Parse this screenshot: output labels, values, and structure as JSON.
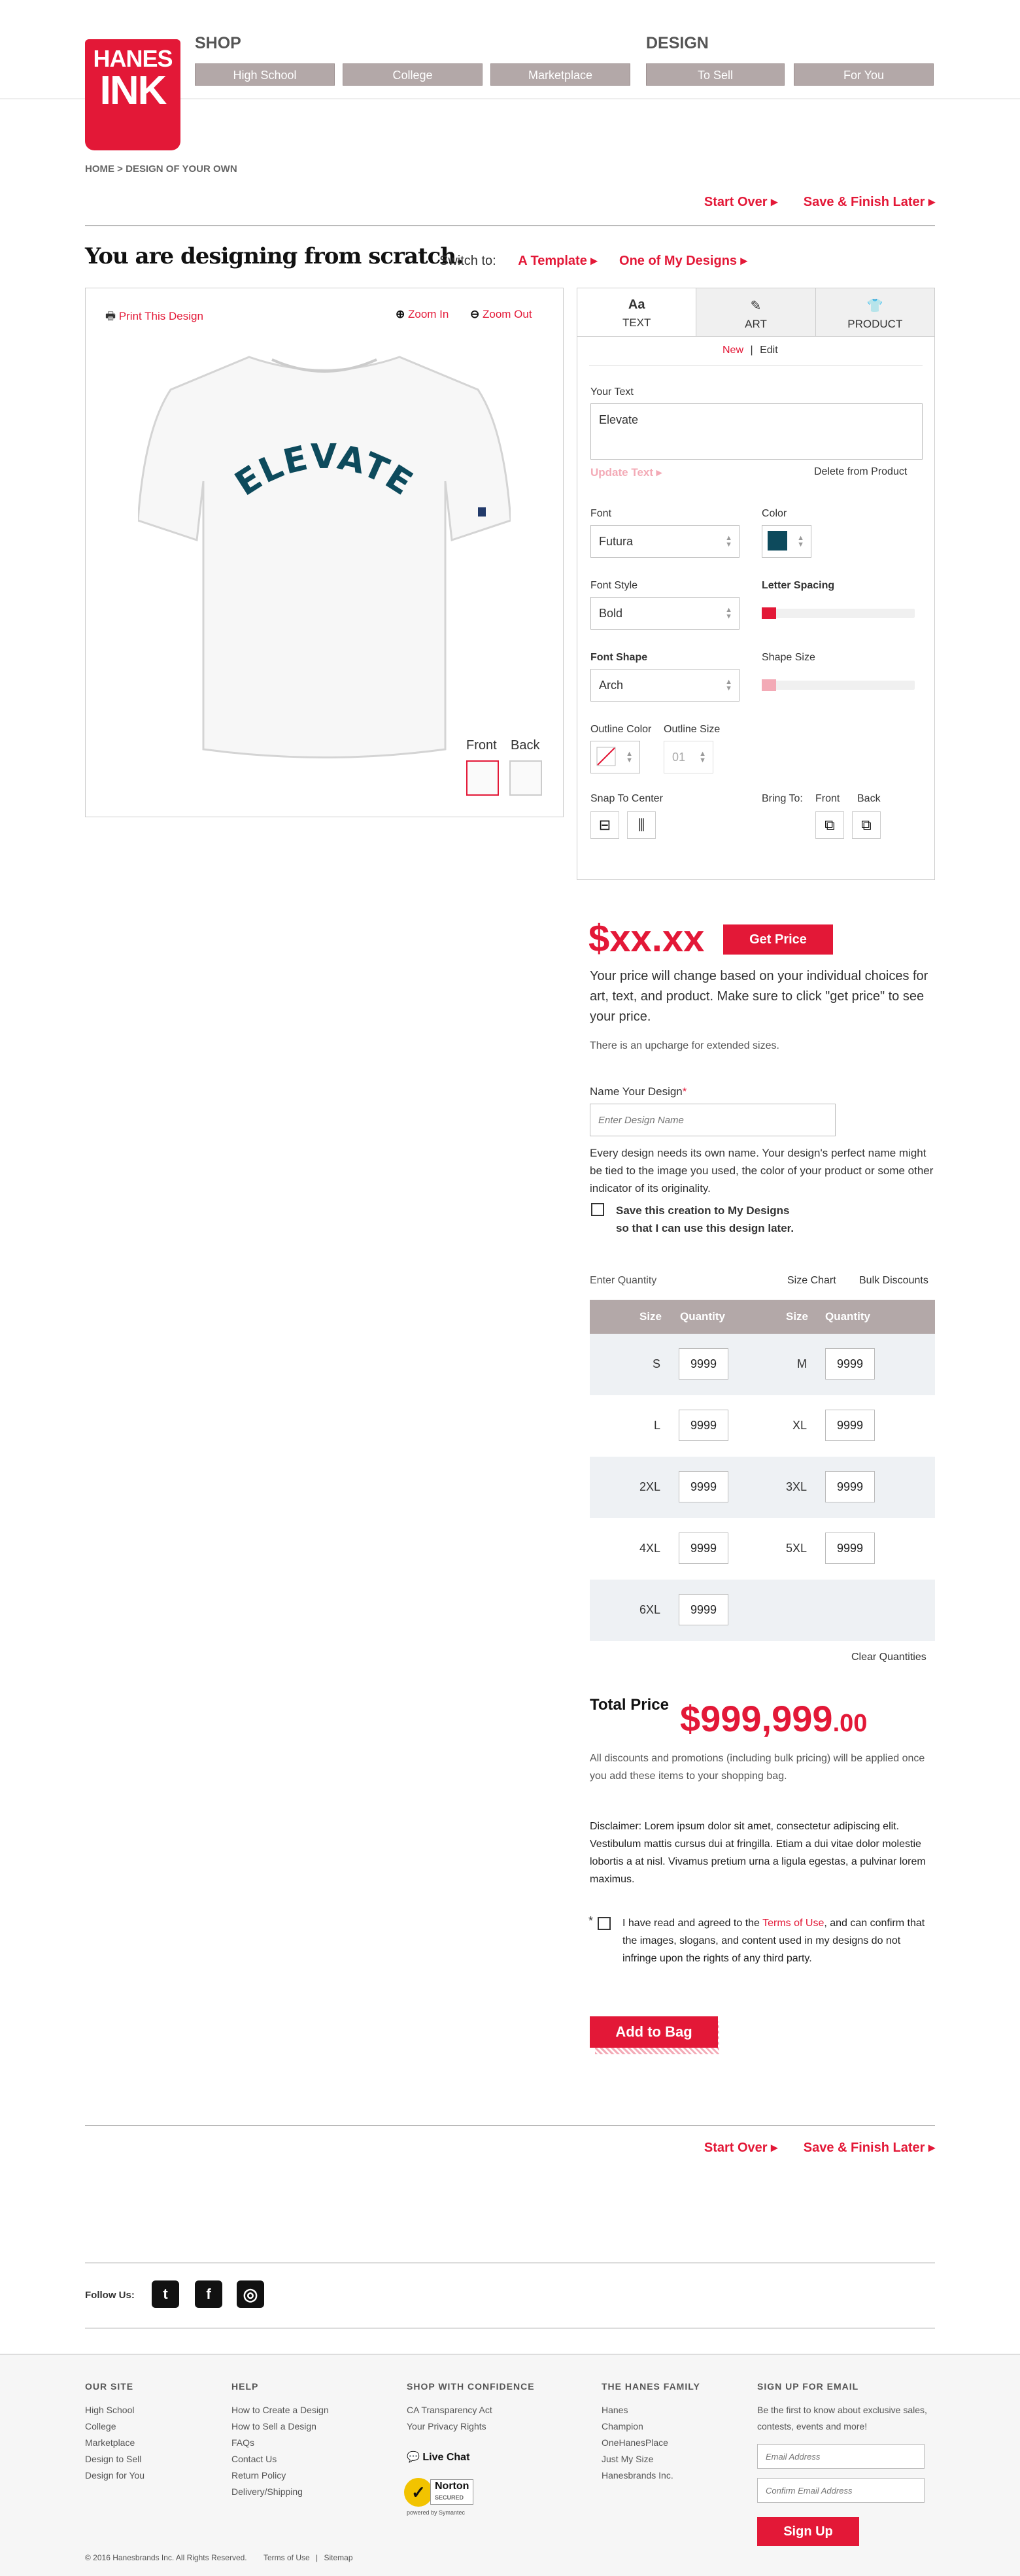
{
  "header": {
    "logo_line1": "HANES",
    "logo_line2": "INK",
    "shop_label": "SHOP",
    "design_label": "DESIGN",
    "shop_items": [
      "High School",
      "College",
      "Marketplace"
    ],
    "design_items": [
      "To Sell",
      "For You"
    ]
  },
  "breadcrumb": {
    "home": "HOME",
    "sep": ">",
    "current": "DESIGN OF YOUR OWN"
  },
  "actions": {
    "start_over": "Start Over",
    "save_finish": "Save & Finish Later"
  },
  "page_title": "You are designing from scratch.",
  "switch": {
    "label": "Switch to:",
    "template": "A Template",
    "my_designs": "One of My Designs"
  },
  "canvas": {
    "print": "Print This Design",
    "zoom_in": "Zoom In",
    "zoom_out": "Zoom Out",
    "shirt_text": "ELEVATE",
    "shirt_text_color": "#0d4a5c",
    "front": "Front",
    "back": "Back"
  },
  "panel": {
    "tabs": [
      {
        "icon": "text-icon",
        "glyph": "Aa",
        "label": "TEXT"
      },
      {
        "icon": "brush-icon",
        "glyph": "✎",
        "label": "ART"
      },
      {
        "icon": "tshirt-icon",
        "glyph": "👕",
        "label": "PRODUCT"
      }
    ],
    "new": "New",
    "divider": "|",
    "edit": "Edit",
    "your_text_label": "Your Text",
    "your_text_value": "Elevate",
    "update_text": "Update Text",
    "delete": "Delete from Product",
    "font_label": "Font",
    "font_value": "Futura",
    "color_label": "Color",
    "color_value": "#0d4a5c",
    "font_style_label": "Font Style",
    "font_style_value": "Bold",
    "letter_spacing_label": "Letter Spacing",
    "letter_spacing_level": 0,
    "font_shape_label": "Font Shape",
    "font_shape_value": "Arch",
    "shape_size_label": "Shape Size",
    "shape_size_level": 0,
    "outline_color_label": "Outline Color",
    "outline_size_label": "Outline Size",
    "outline_size_value": "01",
    "snap_label": "Snap To Center",
    "bring_label": "Bring To:",
    "bring_front": "Front",
    "bring_back": "Back"
  },
  "pricing": {
    "price": "$xx.xx",
    "get_price": "Get Price",
    "desc": "Your price will change based on your individual choices for art, text, and product. Make sure to click \"get price\" to see your price.",
    "upcharge": "There is an upcharge for extended sizes."
  },
  "name_design": {
    "label": "Name Your Design",
    "required": "*",
    "placeholder": "Enter Design Name",
    "desc": "Every design needs its own name. Your design's perfect name might be tied to the image you used, the color of your product or some other indicator of its originality.",
    "save_line1": "Save this creation to My Designs",
    "save_line2": "so that I can use this design later."
  },
  "quantity": {
    "label": "Enter Quantity",
    "size_chart": "Size Chart",
    "bulk": "Bulk Discounts",
    "col_size": "Size",
    "col_qty": "Quantity",
    "rows": [
      [
        {
          "size": "S",
          "qty": "9999"
        },
        {
          "size": "M",
          "qty": "9999"
        }
      ],
      [
        {
          "size": "L",
          "qty": "9999"
        },
        {
          "size": "XL",
          "qty": "9999"
        }
      ],
      [
        {
          "size": "2XL",
          "qty": "9999"
        },
        {
          "size": "3XL",
          "qty": "9999"
        }
      ],
      [
        {
          "size": "4XL",
          "qty": "9999"
        },
        {
          "size": "5XL",
          "qty": "9999"
        }
      ],
      [
        {
          "size": "6XL",
          "qty": "9999"
        }
      ]
    ],
    "clear": "Clear Quantities"
  },
  "total": {
    "label": "Total Price",
    "value": "$999,999",
    "cents": ".00",
    "note": "All discounts and promotions (including bulk pricing) will be applied once you add these items to your shopping bag.",
    "disclaimer": "Disclaimer: Lorem ipsum dolor sit amet, consectetur adipiscing elit. Vestibulum mattis cursus dui at fringilla. Etiam a dui vitae dolor molestie lobortis a at nisl. Vivamus pretium urna a ligula egestas, a pulvinar lorem maximus.",
    "agree_pre": "I have read and agreed to the ",
    "agree_link": "Terms of Use",
    "agree_post": ", and can confirm that the images, slogans, and content used in my designs do not infringe upon the rights of any third party.",
    "add_to_bag": "Add to Bag"
  },
  "follow": {
    "label": "Follow Us:",
    "icons": [
      "twitter-icon",
      "facebook-icon",
      "instagram-icon"
    ]
  },
  "footer": {
    "our_site": {
      "title": "OUR SITE",
      "items": [
        "High School",
        "College",
        "Marketplace",
        "Design to Sell",
        "Design for You"
      ]
    },
    "help": {
      "title": "HELP",
      "items": [
        "How to Create a Design",
        "How to Sell a Design",
        "FAQs",
        "Contact Us",
        "Return Policy",
        "Delivery/Shipping"
      ]
    },
    "confidence": {
      "title": "SHOP WITH CONFIDENCE",
      "items": [
        "CA Transparency Act",
        "Your Privacy Rights"
      ],
      "live_chat": "Live Chat",
      "norton": "Norton",
      "norton_sub": "SECURED",
      "norton_by": "powered by Symantec"
    },
    "family": {
      "title": "THE HANES FAMILY",
      "items": [
        "Hanes",
        "Champion",
        "OneHanesPlace",
        "Just My Size",
        "Hanesbrands Inc."
      ]
    },
    "email": {
      "title": "SIGN UP FOR EMAIL",
      "desc": "Be the first to know about exclusive sales, contests, events and more!",
      "email_ph": "Email Address",
      "confirm_ph": "Confirm Email Address",
      "signup": "Sign Up"
    },
    "copyright": "© 2016 Hanesbrands Inc. All Rights Reserved.",
    "terms": "Terms of Use",
    "sitemap": "Sitemap"
  }
}
